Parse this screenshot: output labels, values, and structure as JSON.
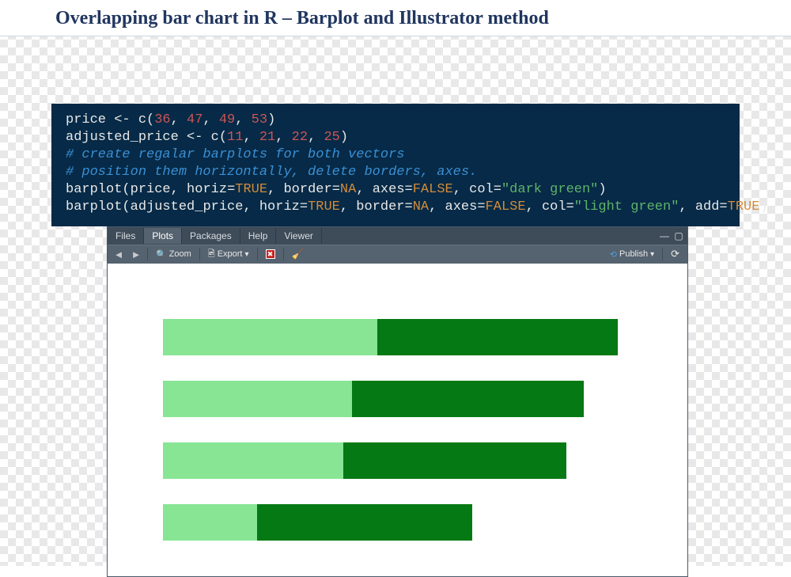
{
  "title": "Overlapping bar chart in R – Barplot and Illustrator method",
  "code": {
    "l1_var": "price",
    "l1_nums": [
      "36",
      "47",
      "49",
      "53"
    ],
    "l2_var": "adjusted_price",
    "l2_nums": [
      "11",
      "21",
      "22",
      "25"
    ],
    "c1": "# create regalar barplots for both vectors",
    "c2": "# position them horizontally, delete borders, axes.",
    "l5_fn": "barplot",
    "l5_arg_var": "price",
    "l5_horiz_k": "horiz",
    "l5_horiz_v": "TRUE",
    "l5_border_k": "border",
    "l5_border_v": "NA",
    "l5_axes_k": "axes",
    "l5_axes_v": "FALSE",
    "l5_col_k": "col",
    "l5_col_v": "\"dark green\"",
    "l6_fn": "barplot",
    "l6_arg_var": "adjusted_price",
    "l6_horiz_k": "horiz",
    "l6_horiz_v": "TRUE",
    "l6_border_k": "border",
    "l6_border_v": "NA",
    "l6_axes_k": "axes",
    "l6_axes_v": "FALSE",
    "l6_col_k": "col",
    "l6_col_v": "\"light green\"",
    "l6_add_k": "add",
    "l6_add_v": "TRUE"
  },
  "pane": {
    "tabs": {
      "files": "Files",
      "plots": "Plots",
      "packages": "Packages",
      "help": "Help",
      "viewer": "Viewer"
    },
    "toolbar": {
      "zoom": "Zoom",
      "export": "Export",
      "publish": "Publish"
    }
  },
  "chart_data": {
    "type": "bar",
    "orientation": "horizontal",
    "overlapping": true,
    "series": [
      {
        "name": "price",
        "color": "#057913",
        "values": [
          36,
          47,
          49,
          53
        ]
      },
      {
        "name": "adjusted_price",
        "color": "#87e594",
        "values": [
          11,
          21,
          22,
          25
        ]
      }
    ],
    "xlim": [
      0,
      53
    ],
    "axes": false,
    "border": false,
    "draw_order_top_to_bottom_index": [
      3,
      2,
      1,
      0
    ]
  }
}
